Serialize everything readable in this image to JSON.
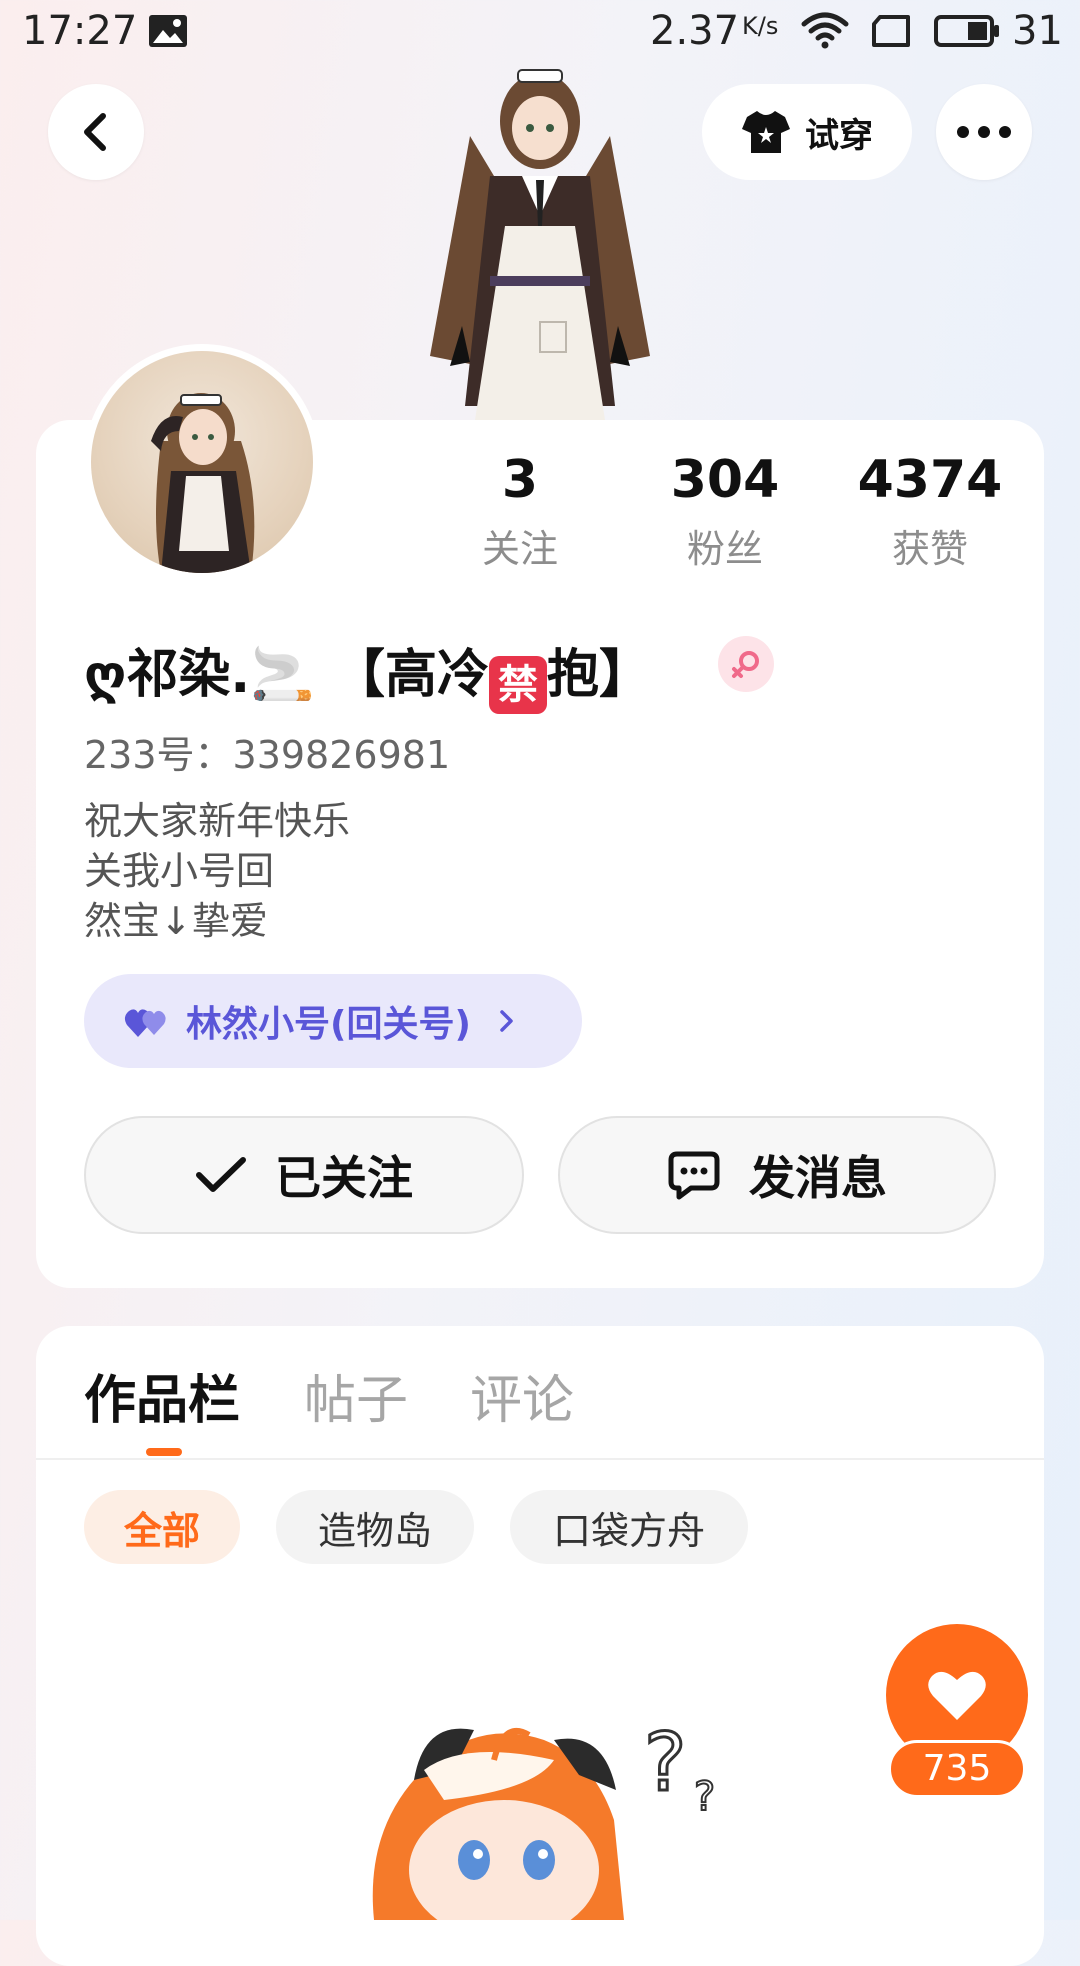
{
  "status_bar": {
    "time": "17:27",
    "speed": "2.37",
    "speed_unit": "K/s",
    "battery": "31"
  },
  "header": {
    "tryon_label": "试穿"
  },
  "stats": [
    {
      "value": "3",
      "label": "关注"
    },
    {
      "value": "304",
      "label": "粉丝"
    },
    {
      "value": "4374",
      "label": "获赞"
    }
  ],
  "profile": {
    "nickname_part1": "ღ祁染.🚬 【高冷",
    "nickname_ban": "禁",
    "nickname_part2": "抱】",
    "uid": "233号：339826981",
    "bio_line1": "祝大家新年快乐",
    "bio_line2": "关我小号回",
    "bio_line3": "然宝↓挚爱",
    "alt_account": "林然小号(回关号)"
  },
  "actions": {
    "followed_label": "已关注",
    "message_label": "发消息"
  },
  "tabs": [
    "作品栏",
    "帖子",
    "评论"
  ],
  "filters": [
    "全部",
    "造物岛",
    "口袋方舟"
  ],
  "likes": {
    "count": "735"
  },
  "colors": {
    "accent": "#ff6a1a",
    "alt_tag_bg": "#e9e8fb",
    "alt_tag_text": "#5a56d8"
  }
}
